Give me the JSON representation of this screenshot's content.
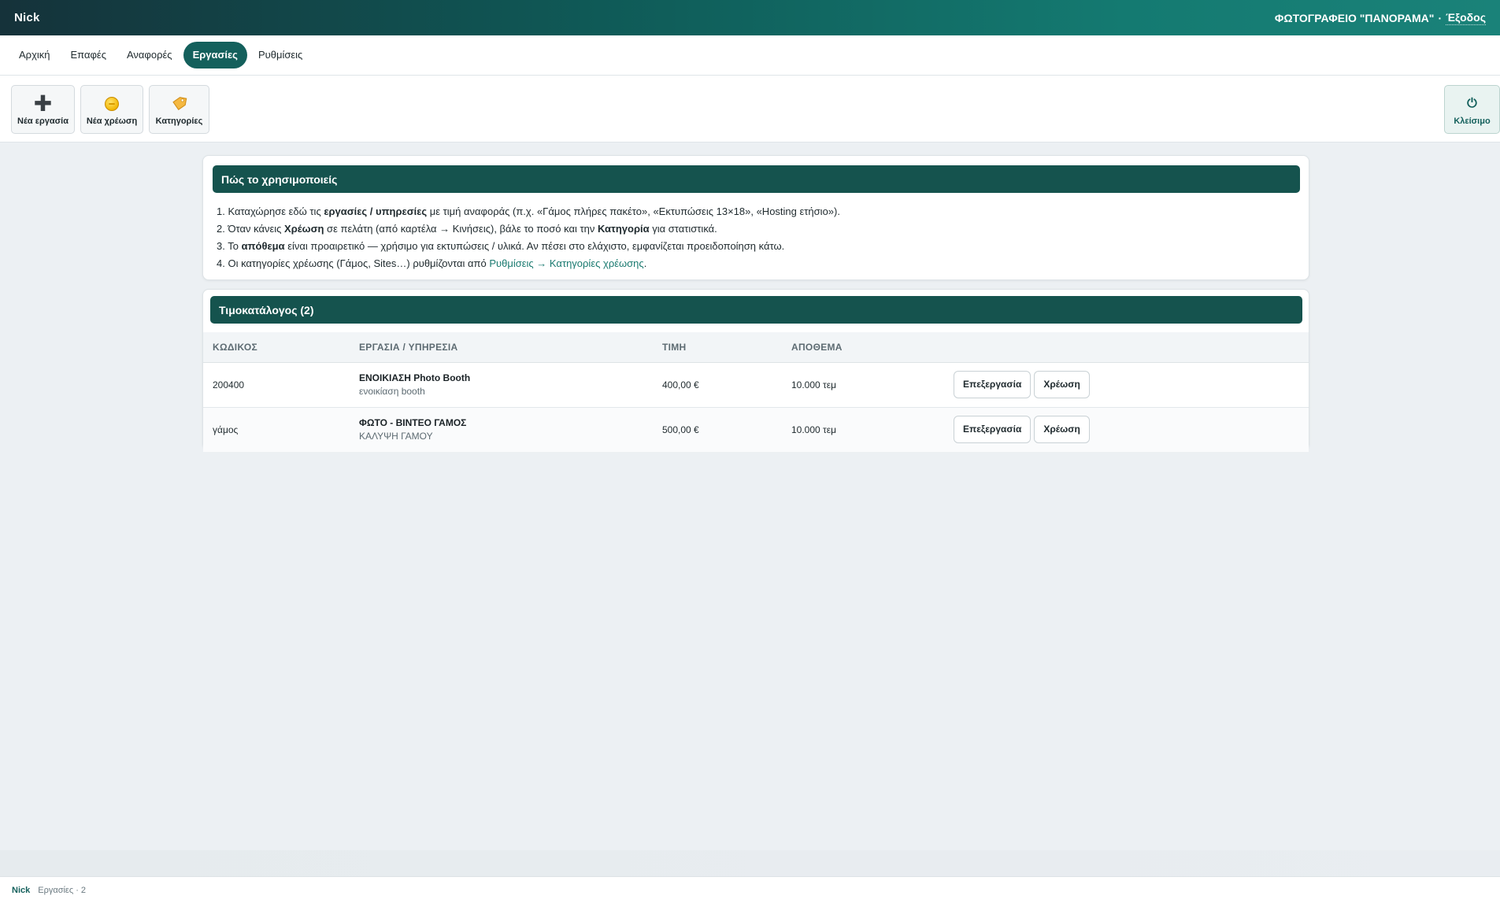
{
  "topbar": {
    "brand": "Nick",
    "studio_name": "ΦΩΤΟΓΡΑΦΕΙΟ \"ΠΑΝΟΡΑΜΑ\"",
    "separator": "·",
    "logout_label": "Έξοδος"
  },
  "nav": {
    "tabs": [
      {
        "label": "Αρχική"
      },
      {
        "label": "Επαφές"
      },
      {
        "label": "Αναφορές"
      },
      {
        "label": "Εργασίες",
        "active": true
      },
      {
        "label": "Ρυθμίσεις"
      }
    ]
  },
  "toolbar": {
    "new_job": {
      "label": "Νέα εργασία",
      "icon": "plus-icon"
    },
    "new_charge": {
      "label": "Νέα χρέωση",
      "icon": "coin-icon"
    },
    "categories": {
      "label": "Κατηγορίες",
      "icon": "tag-icon"
    },
    "close": {
      "label": "Κλείσιμο",
      "icon": "power-icon"
    }
  },
  "howto": {
    "title": "Πώς το χρησιμοποιείς",
    "steps": [
      {
        "n": "1.",
        "p1": " Καταχώρησε εδώ τις ",
        "b1": "εργασίες / υπηρεσίες",
        "p2": " με τιμή αναφοράς (π.χ. «Γάμος πλήρες πακέτο», «Εκτυπώσεις 13×18», «Hosting ετήσιο»)."
      },
      {
        "n": "2.",
        "p1": " Όταν κάνεις ",
        "b1": "Χρέωση",
        "p2": " σε πελάτη (από καρτέλα → Κινήσεις), βάλε το ποσό και την ",
        "b2": "Κατηγορία",
        "p3": " για στατιστικά."
      },
      {
        "n": "3.",
        "p1": " Το ",
        "b1": "απόθεμα",
        "p2": " είναι προαιρετικό — χρήσιμο για εκτυπώσεις / υλικά. Αν πέσει στο ελάχιστο, εμφανίζεται προειδοποίηση κάτω."
      },
      {
        "n": "4.",
        "p1": " Οι κατηγορίες χρέωσης (Γάμος, Sites…) ρυθμίζονται από ",
        "link": "Ρυθμίσεις → Κατηγορίες χρέωσης",
        "p2": "."
      }
    ]
  },
  "pricelist": {
    "title": "Τιμοκατάλογος (2)",
    "columns": [
      "ΚΩΔΙΚΟΣ",
      "ΕΡΓΑΣΙΑ / ΥΠΗΡΕΣΙΑ",
      "ΤΙΜΗ",
      "ΑΠΟΘΕΜΑ",
      ""
    ],
    "rows": [
      {
        "code": "200400",
        "name": "ΕΝΟΙΚΙΑΣΗ Photo Booth",
        "desc": "ενοικίαση booth",
        "price": "400,00 €",
        "stock": "10.000 τεμ",
        "edit": "Επεξεργασία",
        "charge": "Χρέωση"
      },
      {
        "code": "γάμος",
        "name": "ΦΩΤΟ - ΒΙΝΤΕΟ ΓΑΜΟΣ",
        "desc": "ΚΑΛΥΨΗ ΓΑΜΟΥ",
        "price": "500,00 €",
        "stock": "10.000 τεμ",
        "edit": "Επεξεργασία",
        "charge": "Χρέωση"
      }
    ]
  },
  "status": {
    "brand": "Nick",
    "text": "Εργασίες · 2"
  }
}
